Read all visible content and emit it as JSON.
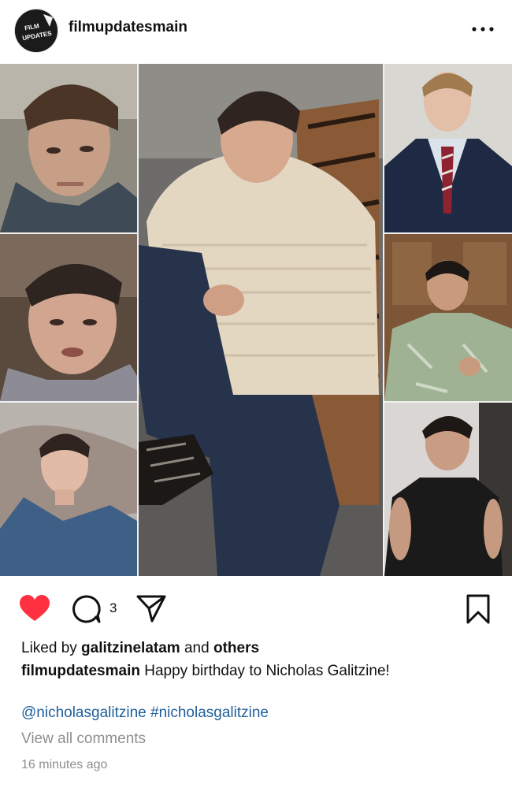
{
  "post": {
    "username": "filmupdatesmain",
    "avatar_text_line1": "FILM",
    "avatar_text_line2": "UPDATES",
    "more_icon": "more-horizontal-icon"
  },
  "collage": {
    "tiles": [
      "tile-left-top",
      "tile-left-middle",
      "tile-left-bottom",
      "tile-center",
      "tile-right-top",
      "tile-right-middle",
      "tile-right-bottom"
    ]
  },
  "actions": {
    "heart_color": "#ff3040",
    "comment_count": "3",
    "icons": [
      "heart-icon",
      "comment-icon",
      "share-icon",
      "bookmark-icon"
    ]
  },
  "likes": {
    "prefix": "Liked by ",
    "user": "galitzinelatam",
    "middle": " and ",
    "others": "others"
  },
  "caption": {
    "username": "filmupdatesmain",
    "text": " Happy birthday to Nicholas Galitzine!"
  },
  "tags": {
    "mention": "@nicholasgalitzine",
    "hashtag": "#nicholasgalitzine"
  },
  "view_comments": "View all comments",
  "timestamp": "16 minutes ago",
  "colors": {
    "link": "#1f5f9b",
    "muted": "#8e8e8e",
    "heart": "#ff3040"
  }
}
